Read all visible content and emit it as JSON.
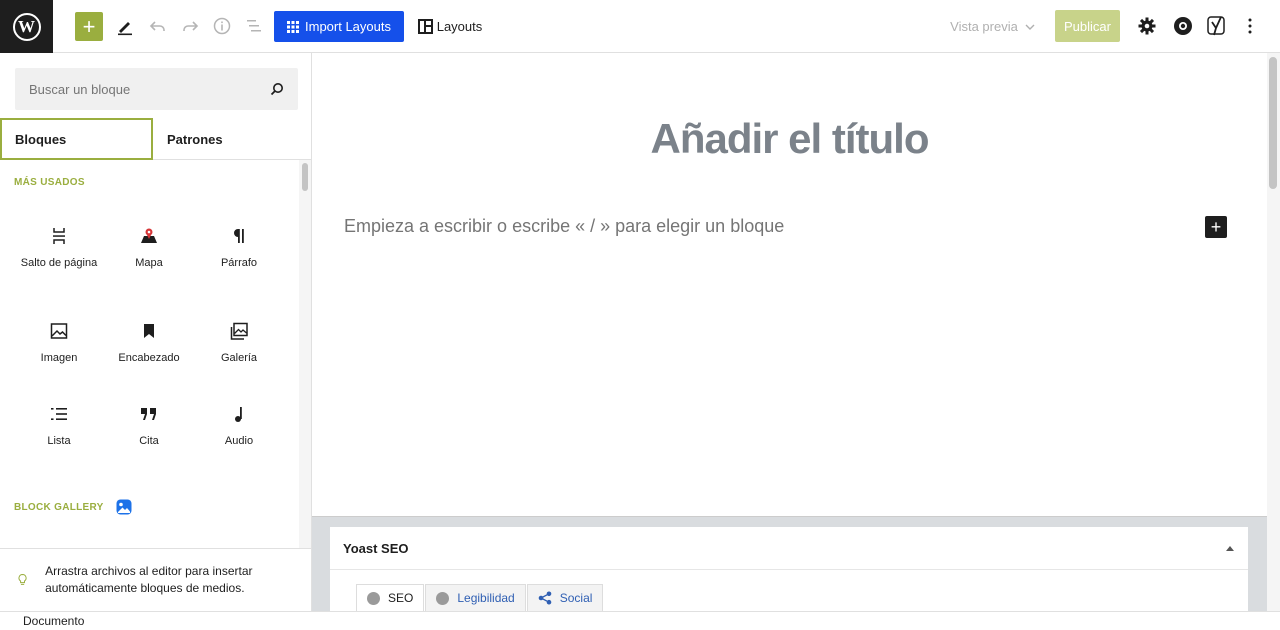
{
  "toolbar": {
    "wp_logo_letter": "W",
    "add_symbol": "+",
    "import_layouts_label": "Import Layouts",
    "layouts_label": "Layouts",
    "preview_label": "Vista previa",
    "publish_label": "Publicar"
  },
  "inserter": {
    "search_placeholder": "Buscar un bloque",
    "tabs": [
      {
        "label": "Bloques"
      },
      {
        "label": "Patrones"
      }
    ],
    "most_used_title": "MÁS USADOS",
    "blocks": [
      {
        "label": "Salto de página",
        "icon": "page-break-icon"
      },
      {
        "label": "Mapa",
        "icon": "map-icon"
      },
      {
        "label": "Párrafo",
        "icon": "paragraph-icon"
      },
      {
        "label": "Imagen",
        "icon": "image-icon"
      },
      {
        "label": "Encabezado",
        "icon": "bookmark-icon"
      },
      {
        "label": "Galería",
        "icon": "gallery-icon"
      },
      {
        "label": "Lista",
        "icon": "list-icon"
      },
      {
        "label": "Cita",
        "icon": "quote-icon"
      },
      {
        "label": "Audio",
        "icon": "audio-icon"
      }
    ],
    "block_gallery_title": "BLOCK GALLERY",
    "tip": "Arrastra archivos al editor para insertar automáticamente bloques de medios."
  },
  "editor": {
    "title_placeholder": "Añadir el título",
    "paragraph_placeholder": "Empieza a escribir o escribe « / » para elegir un bloque",
    "inline_add_symbol": "+"
  },
  "yoast": {
    "title": "Yoast SEO",
    "tabs": [
      {
        "label": "SEO"
      },
      {
        "label": "Legibilidad"
      },
      {
        "label": "Social"
      }
    ]
  },
  "footer": {
    "breadcrumb": "Documento"
  },
  "colors": {
    "accent": "#9aae3f",
    "import_blue": "#1550ea",
    "publish_disabled": "#c8d38a",
    "title_gray": "#7b828a"
  }
}
